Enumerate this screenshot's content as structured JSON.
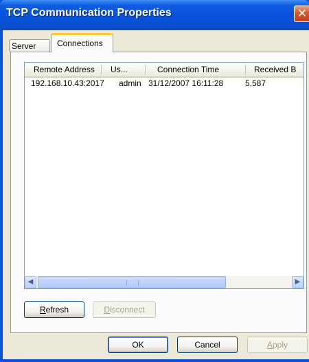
{
  "window": {
    "title": "TCP Communication Properties",
    "close_glyph": "✕"
  },
  "tabs": [
    {
      "label": "Server",
      "selected": false
    },
    {
      "label": "Connections",
      "selected": true
    }
  ],
  "listview": {
    "columns": [
      "Remote Address",
      "Us...",
      "Connection Time",
      "Received B"
    ],
    "rows": [
      [
        "192.168.10.43:2017",
        "admin",
        "31/12/2007 16:11:28",
        "5,587"
      ]
    ]
  },
  "scrollbar": {
    "left_glyph": "◀",
    "right_glyph": "▶"
  },
  "buttons": {
    "refresh": {
      "mnemonic": "R",
      "rest": "efresh"
    },
    "disconnect": {
      "mnemonic": "D",
      "rest": "isconnect"
    },
    "ok": "OK",
    "cancel": "Cancel",
    "apply": {
      "mnemonic": "A",
      "rest": "pply"
    }
  },
  "colors": {
    "title_bar": "#0a52d6",
    "dialog_face": "#ece9d8",
    "tab_highlight": "#ffc83c",
    "close_button": "#d7582f"
  }
}
